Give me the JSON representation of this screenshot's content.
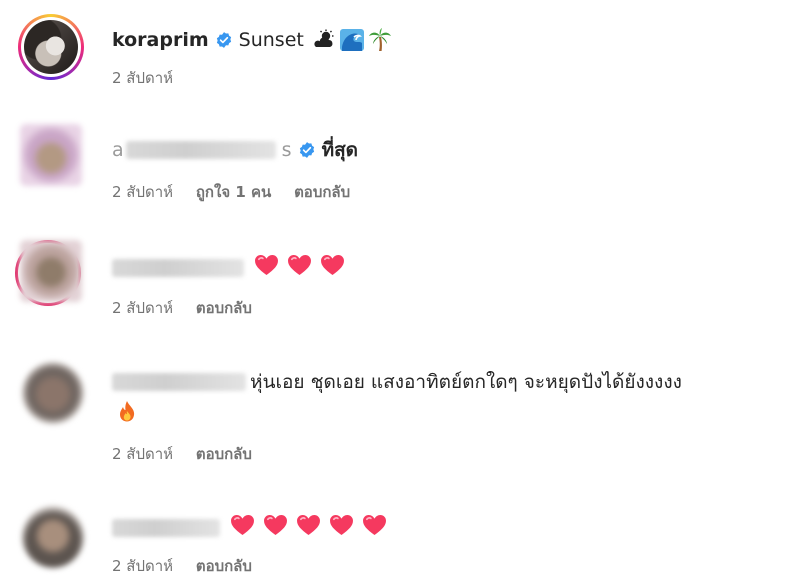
{
  "comments": [
    {
      "username": "koraprim",
      "verified": true,
      "text": "Sunset",
      "emojis": [
        "cloud-sun-emoji",
        "wave-emoji",
        "palm-tree-emoji"
      ],
      "time": "2 สัปดาห์"
    },
    {
      "username": "a",
      "username_tail": "s",
      "verified": true,
      "text": "ที่สุด",
      "time": "2 สัปดาห์",
      "likes": "ถูกใจ 1 คน",
      "reply": "ตอบกลับ"
    },
    {
      "username": "",
      "text": "",
      "hearts": 3,
      "time": "2 สัปดาห์",
      "reply": "ตอบกลับ"
    },
    {
      "username": "",
      "text": "หุ่นเอย ชุดเอย แสงอาทิตย์ตกใดๆ จะหยุดปังได้ยังงงงง",
      "emojis": [
        "fire-emoji"
      ],
      "time": "2 สัปดาห์",
      "reply": "ตอบกลับ"
    },
    {
      "username": "",
      "text": "",
      "hearts": 5,
      "time": "2 สัปดาห์",
      "reply": "ตอบกลับ"
    }
  ],
  "colors": {
    "verified": "#3897f0",
    "heart": "#f5395f",
    "meta": "#737373",
    "text": "#262626"
  }
}
